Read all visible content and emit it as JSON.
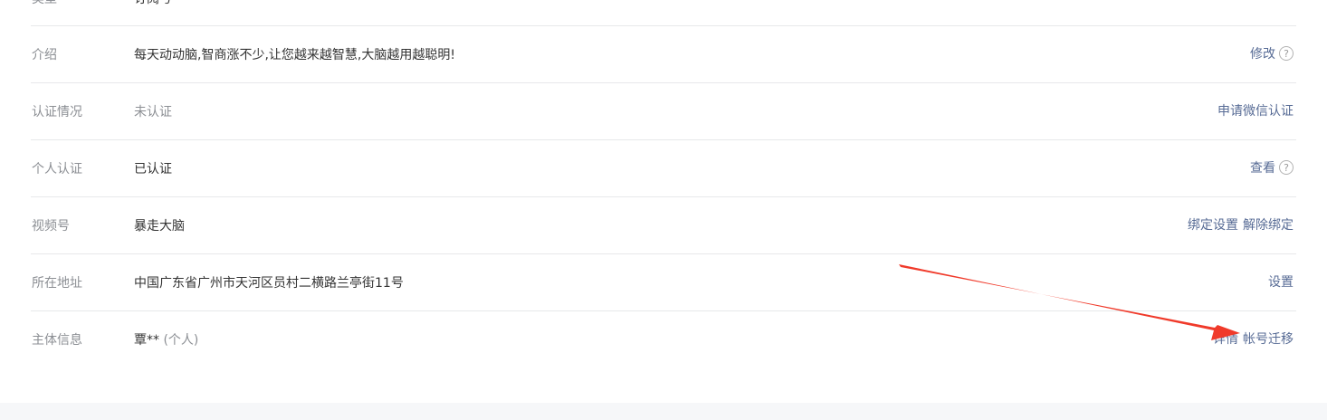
{
  "partial_top_row": {
    "label": "类型",
    "value": "订阅号"
  },
  "rows": [
    {
      "label": "介绍",
      "value": "每天动动脑,智商涨不少,让您越来越智慧,大脑越用越聪明!",
      "action": "修改",
      "help": "?"
    },
    {
      "label": "认证情况",
      "value": "未认证",
      "action": "申请微信认证"
    },
    {
      "label": "个人认证",
      "value": "已认证",
      "action": "查看",
      "help": "?"
    },
    {
      "label": "视频号",
      "value": "暴走大脑",
      "action1": "绑定设置",
      "action2": "解除绑定"
    },
    {
      "label": "所在地址",
      "value": "中国广东省广州市天河区员村二横路兰亭街11号",
      "action": "设置"
    },
    {
      "label": "主体信息",
      "value": "覃**",
      "value_sub": "(个人)",
      "action1": "详情",
      "action2": "帐号迁移"
    }
  ],
  "annotation": {
    "arrow_color": "#f03a2a"
  }
}
